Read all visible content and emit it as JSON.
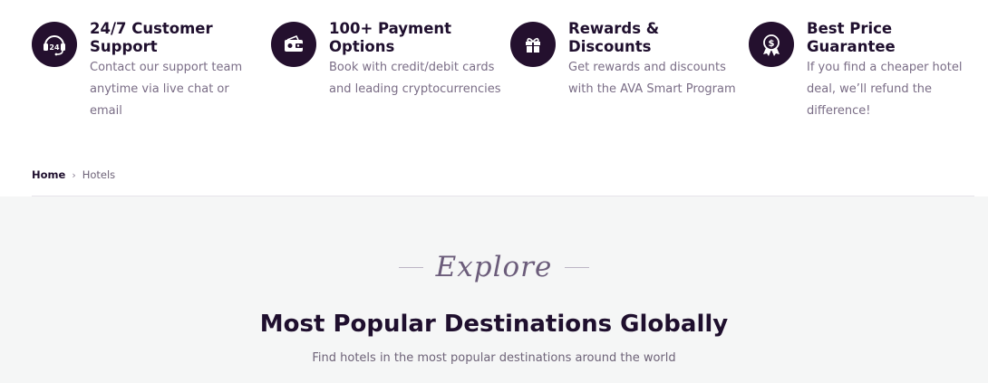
{
  "features": [
    {
      "icon": "headset-24-icon",
      "title": "24/7 Customer Support",
      "description": "Contact our support team anytime via live chat or email"
    },
    {
      "icon": "wallet-icon",
      "title": "100+ Payment Options",
      "description": "Book with credit/debit cards and leading cryptocurrencies"
    },
    {
      "icon": "gift-icon",
      "title": "Rewards & Discounts",
      "description": "Get rewards and discounts with the AVA Smart Program"
    },
    {
      "icon": "price-badge-icon",
      "title": "Best Price Guarantee",
      "description": "If you find a cheaper hotel deal, we’ll refund the difference!"
    }
  ],
  "breadcrumb": {
    "home": "Home",
    "current": "Hotels"
  },
  "section": {
    "eyebrow": "Explore",
    "title": "Most Popular Destinations Globally",
    "subtitle": "Find hotels in the most popular destinations around the world"
  },
  "colors": {
    "icon_bg": "#24102e",
    "title": "#1f0f2e",
    "muted": "#7a6d86",
    "section_bg": "#f5f6f6"
  }
}
